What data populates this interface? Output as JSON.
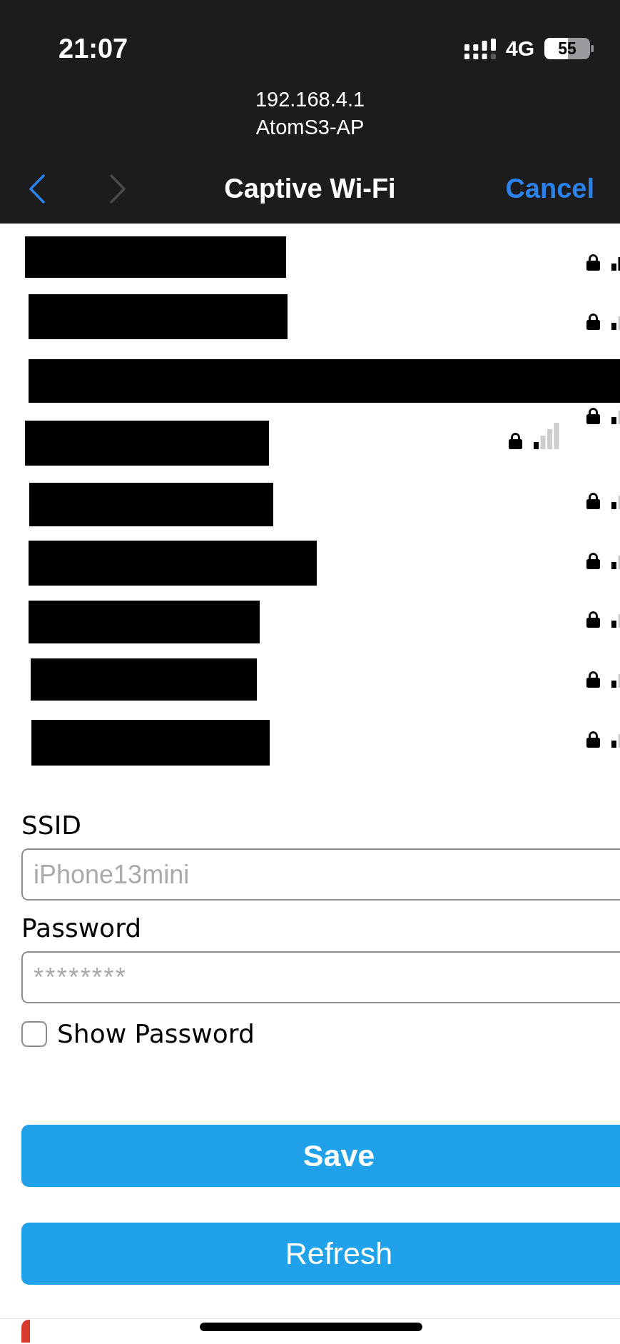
{
  "status_bar": {
    "time": "21:07",
    "network": "4G",
    "battery": "55"
  },
  "header": {
    "host": "192.168.4.1",
    "network_name": "AtomS3-AP"
  },
  "nav": {
    "back": {
      "disabled": false
    },
    "forward": {
      "disabled": true
    },
    "title": "Captive Wi-Fi",
    "cancel": "Cancel"
  },
  "networks": [
    {
      "redacted": true,
      "locked": true,
      "kind": "fair"
    },
    {
      "redacted": true,
      "locked": true,
      "kind": "weak"
    },
    {
      "redacted": true,
      "locked": true,
      "kind": "weak"
    },
    {
      "redacted": true,
      "locked": true,
      "kind": "weak"
    },
    {
      "redacted": true,
      "locked": true,
      "kind": "weak"
    },
    {
      "redacted": true,
      "locked": true,
      "kind": "weak"
    },
    {
      "redacted": true,
      "locked": true,
      "kind": "weak"
    },
    {
      "redacted": true,
      "locked": true,
      "kind": "weak"
    },
    {
      "redacted": true,
      "locked": true,
      "kind": "weak"
    }
  ],
  "form": {
    "fields": [
      {
        "label": "SSID",
        "placeholder": "iPhone13mini"
      },
      {
        "label": "Password",
        "placeholder": "********"
      }
    ],
    "show_password": {
      "label": "Show Password",
      "checked": false
    }
  },
  "buttons": [
    {
      "label": "Save",
      "kind": "primary"
    },
    {
      "label": "Refresh",
      "kind": "secondary"
    }
  ]
}
